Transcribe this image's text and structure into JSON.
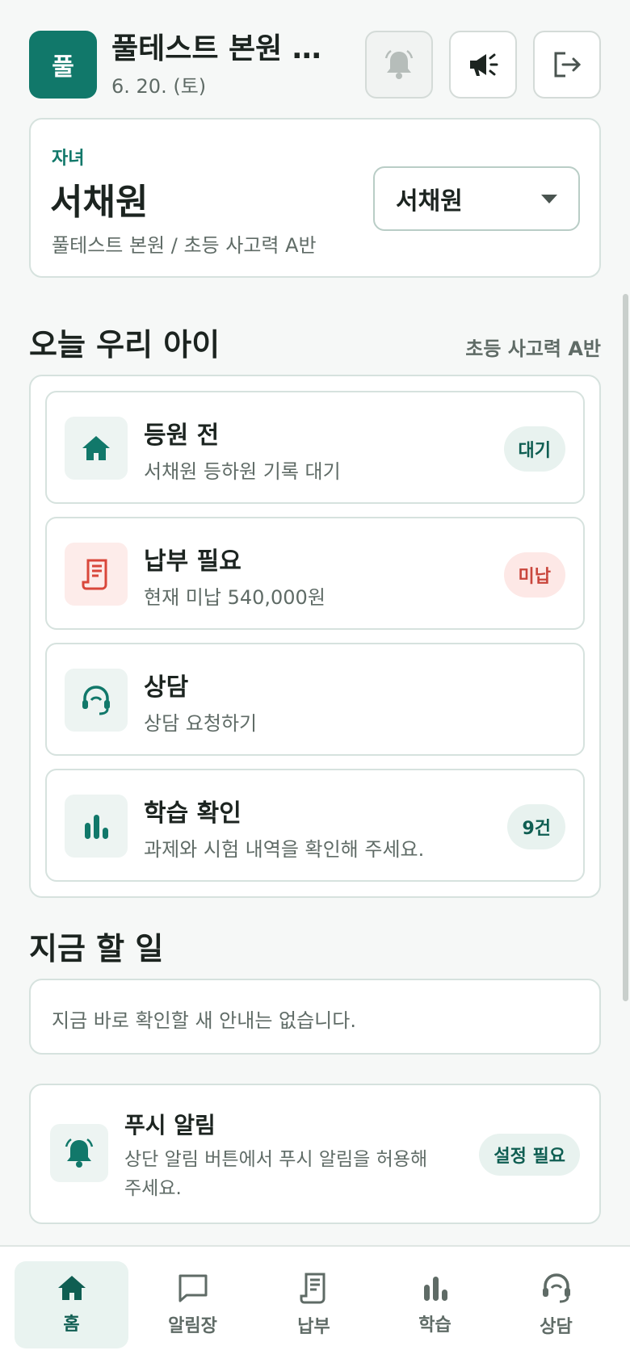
{
  "header": {
    "logo_char": "풀",
    "title": "풀테스트 본원 학원",
    "date": "6. 20. (토)"
  },
  "child": {
    "label": "자녀",
    "name": "서채원",
    "class_path": "풀테스트 본원 / 초등 사고력 A반",
    "selected": "서채원"
  },
  "today": {
    "title": "오늘 우리 아이",
    "class_name": "초등 사고력 A반",
    "items": [
      {
        "title": "등원 전",
        "desc": "서채원 등하원 기록 대기",
        "badge": "대기",
        "icon": "home-icon"
      },
      {
        "title": "납부 필요",
        "desc": "현재 미납 540,000원",
        "badge": "미납",
        "icon": "receipt-icon"
      },
      {
        "title": "상담",
        "desc": "상담 요청하기",
        "badge": "",
        "icon": "headset-icon"
      },
      {
        "title": "학습 확인",
        "desc": "과제와 시험 내역을 확인해 주세요.",
        "badge": "9건",
        "icon": "bar-chart-icon"
      }
    ]
  },
  "todo": {
    "title": "지금 할 일",
    "empty_text": "지금 바로 확인할 새 안내는 없습니다."
  },
  "push": {
    "title": "푸시 알림",
    "desc": "상단 알림 버튼에서 푸시 알림을 허용해 주세요.",
    "badge": "설정 필요"
  },
  "tabs": [
    {
      "label": "홈",
      "icon": "home-icon"
    },
    {
      "label": "알림장",
      "icon": "chat-icon"
    },
    {
      "label": "납부",
      "icon": "receipt-icon"
    },
    {
      "label": "학습",
      "icon": "bar-chart-icon"
    },
    {
      "label": "상담",
      "icon": "headset-icon"
    }
  ],
  "colors": {
    "accent": "#11786a",
    "alert": "#c9463c"
  }
}
